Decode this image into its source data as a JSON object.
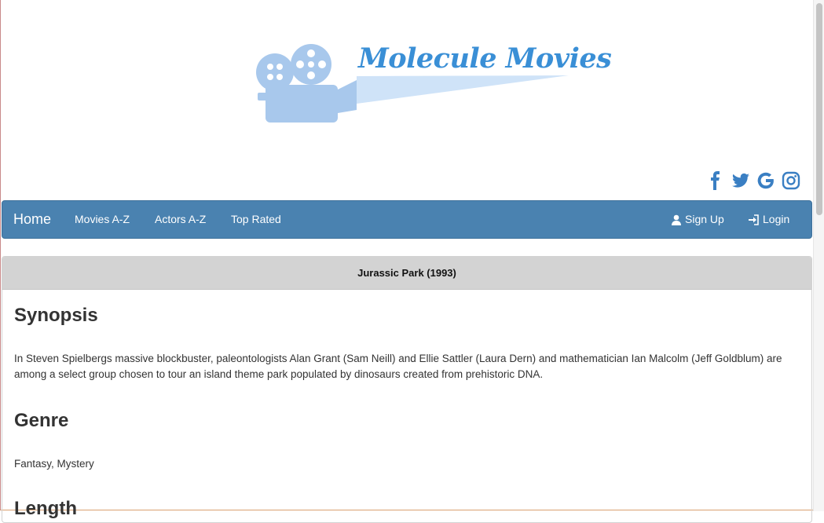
{
  "brand": {
    "logo_text": "Molecule Movies",
    "logo_color": "#3a8fd6"
  },
  "social": [
    {
      "icon": "facebook-icon"
    },
    {
      "icon": "twitter-icon"
    },
    {
      "icon": "google-icon"
    },
    {
      "icon": "instagram-icon"
    }
  ],
  "nav": {
    "home": "Home",
    "movies": "Movies A-Z",
    "actors": "Actors A-Z",
    "top_rated": "Top Rated",
    "sign_up": "Sign Up",
    "login": "Login",
    "bar_color": "#4a82b0"
  },
  "movie": {
    "title": "Jurassic Park (1993)",
    "synopsis_heading": "Synopsis",
    "synopsis": "In Steven Spielbergs massive blockbuster, paleontologists Alan Grant (Sam Neill) and Ellie Sattler (Laura Dern) and mathematician Ian Malcolm (Jeff Goldblum) are among a select group chosen to tour an island theme park populated by dinosaurs created from prehistoric DNA.",
    "genre_heading": "Genre",
    "genre": "Fantasy, Mystery",
    "length_heading": "Length"
  }
}
